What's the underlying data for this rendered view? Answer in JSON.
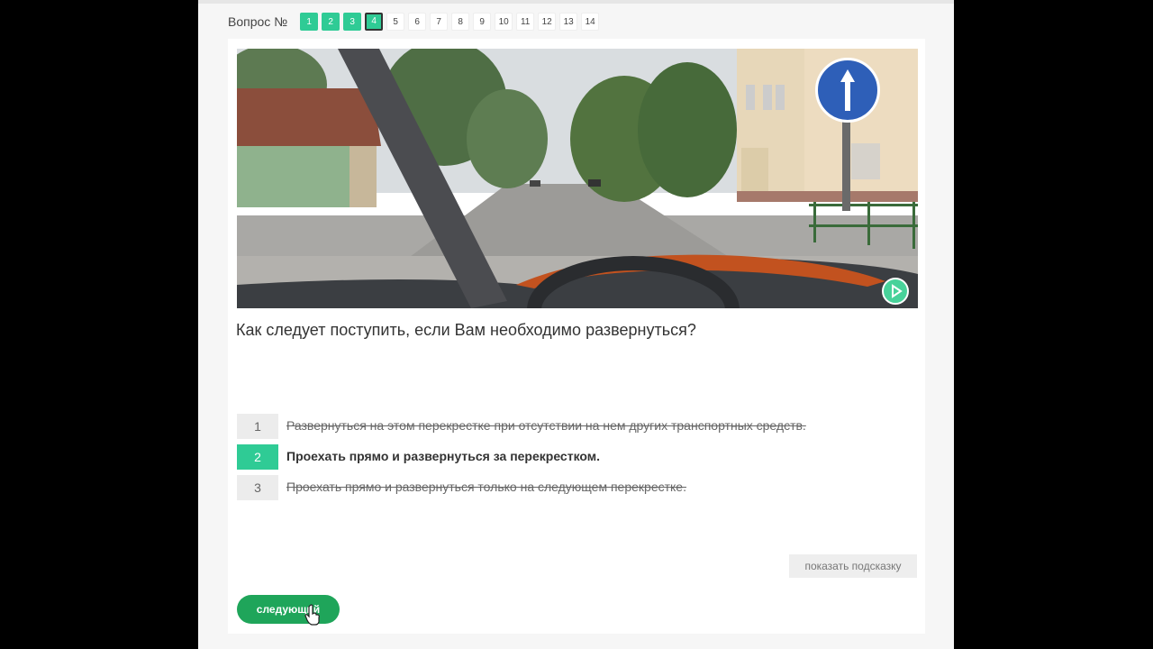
{
  "nav": {
    "label": "Вопрос №",
    "questions": [
      {
        "n": "1",
        "state": "done"
      },
      {
        "n": "2",
        "state": "done"
      },
      {
        "n": "3",
        "state": "done"
      },
      {
        "n": "4",
        "state": "current"
      },
      {
        "n": "5",
        "state": "todo"
      },
      {
        "n": "6",
        "state": "todo"
      },
      {
        "n": "7",
        "state": "todo"
      },
      {
        "n": "8",
        "state": "todo"
      },
      {
        "n": "9",
        "state": "todo"
      },
      {
        "n": "10",
        "state": "todo"
      },
      {
        "n": "11",
        "state": "todo"
      },
      {
        "n": "12",
        "state": "todo"
      },
      {
        "n": "13",
        "state": "todo"
      },
      {
        "n": "14",
        "state": "todo"
      }
    ]
  },
  "scene": {
    "sign": "straight-arrow-sign-icon",
    "play_icon": "play-icon"
  },
  "question": "Как следует поступить, если Вам необходимо развернуться?",
  "answers": [
    {
      "num": "1",
      "text": "Развернуться на этом перекрестке при отсутствии на нем других транспортных средств.",
      "state": "wrong"
    },
    {
      "num": "2",
      "text": "Проехать прямо и развернуться за перекрестком.",
      "state": "correct"
    },
    {
      "num": "3",
      "text": "Проехать прямо и развернуться только на следующем перекрестке.",
      "state": "wrong"
    }
  ],
  "hint_button": "показать подсказку",
  "next_button": "следующий",
  "colors": {
    "accent": "#2fcb95",
    "next": "#1fa55a",
    "background": "#000000"
  }
}
